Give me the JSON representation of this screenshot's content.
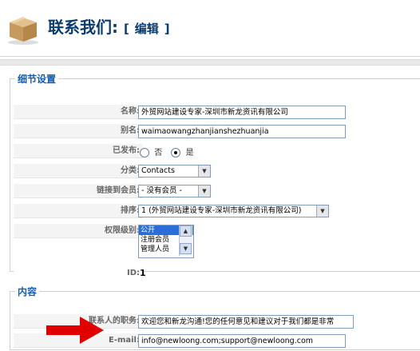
{
  "header": {
    "title": "联系我们:",
    "edit_label": "编辑",
    "bracket_open": "[",
    "bracket_close": "]"
  },
  "details": {
    "legend": "细节设置",
    "name_label": "名称:",
    "name_value": "外贸网站建设专家-深圳市新龙资讯有限公司",
    "alias_label": "别名:",
    "alias_value": "waimaowangzhanjianshezhuanjia",
    "published_label": "已发布:",
    "published_no": "否",
    "published_yes": "是",
    "category_label": "分类:",
    "category_value": "Contacts",
    "link_user_label": "链接到会员:",
    "link_user_value": "- 没有会员 -",
    "order_label": "排序:",
    "order_value": "1 (外贸网站建设专家-深圳市新龙资讯有限公司)",
    "access_label": "权限级别:",
    "access_options": [
      "公开",
      "注册会员",
      "管理人员"
    ],
    "id_label": "ID:",
    "id_value": "1"
  },
  "content": {
    "legend": "内容",
    "position_label": "联系人的职务:",
    "position_value": "欢迎您和新龙沟通!您的任何意见和建议对于我们都是非常",
    "email_label": "E-mail:",
    "email_value": "info@newloong.com;support@newloong.com"
  },
  "colors": {
    "title": "#0b3c6f",
    "legend": "#135cae",
    "arrow": "#e00000"
  }
}
